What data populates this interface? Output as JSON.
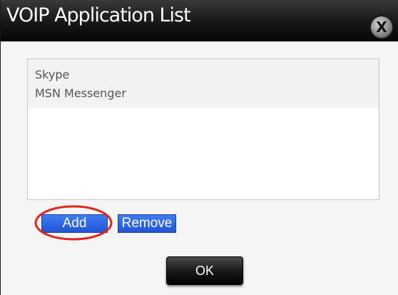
{
  "window": {
    "title": "VOIP Application List",
    "close_label": "X"
  },
  "list": {
    "items": [
      "Skype",
      "MSN Messenger"
    ]
  },
  "buttons": {
    "add_label": "Add",
    "remove_label": "Remove",
    "ok_label": "OK"
  },
  "colors": {
    "titlebar": "#1c1c1c",
    "button_blue": "#2a5fe0",
    "highlight_ring": "#e0261b"
  }
}
